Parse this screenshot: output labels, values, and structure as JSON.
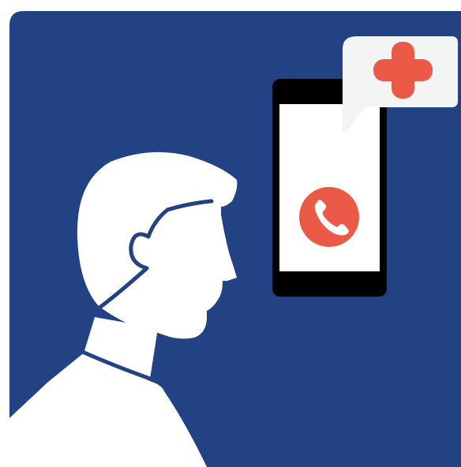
{
  "illustration": {
    "colors": {
      "page_background": "#ffffff",
      "panel_background": "#234283",
      "figure_fill": "#ffffff",
      "phone_body": "#000000",
      "phone_screen": "#ffffff",
      "call_button": "#ea5a47",
      "call_icon": "#ffffff",
      "speech_bubble": "#f3f4f4",
      "medical_cross": "#ea5a47"
    },
    "icons": {
      "call": "phone-handset-icon",
      "medical": "medical-cross-icon"
    }
  }
}
